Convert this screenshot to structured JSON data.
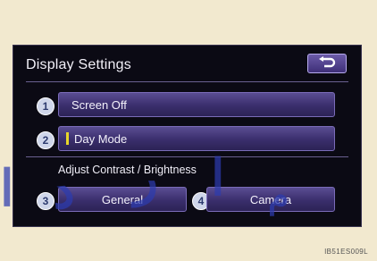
{
  "screen": {
    "title": "Display Settings",
    "back_icon": "return-arrow-icon"
  },
  "buttons": {
    "screen_off": {
      "number": "1",
      "label": "Screen Off"
    },
    "day_mode": {
      "number": "2",
      "label": "Day Mode",
      "indicator_color": "#e8d62a"
    },
    "general": {
      "number": "3",
      "label": "General"
    },
    "camera": {
      "number": "4",
      "label": "Camera"
    }
  },
  "section": {
    "adjust_label": "Adjust Contrast / Brightness"
  },
  "figure_code": "IB51ES009L",
  "colors": {
    "background": "#f2e9cf",
    "screen": "#0b0a14",
    "button_top": "#5a4d92",
    "button_bottom": "#2c2356",
    "watermark": "#2d3caf"
  }
}
